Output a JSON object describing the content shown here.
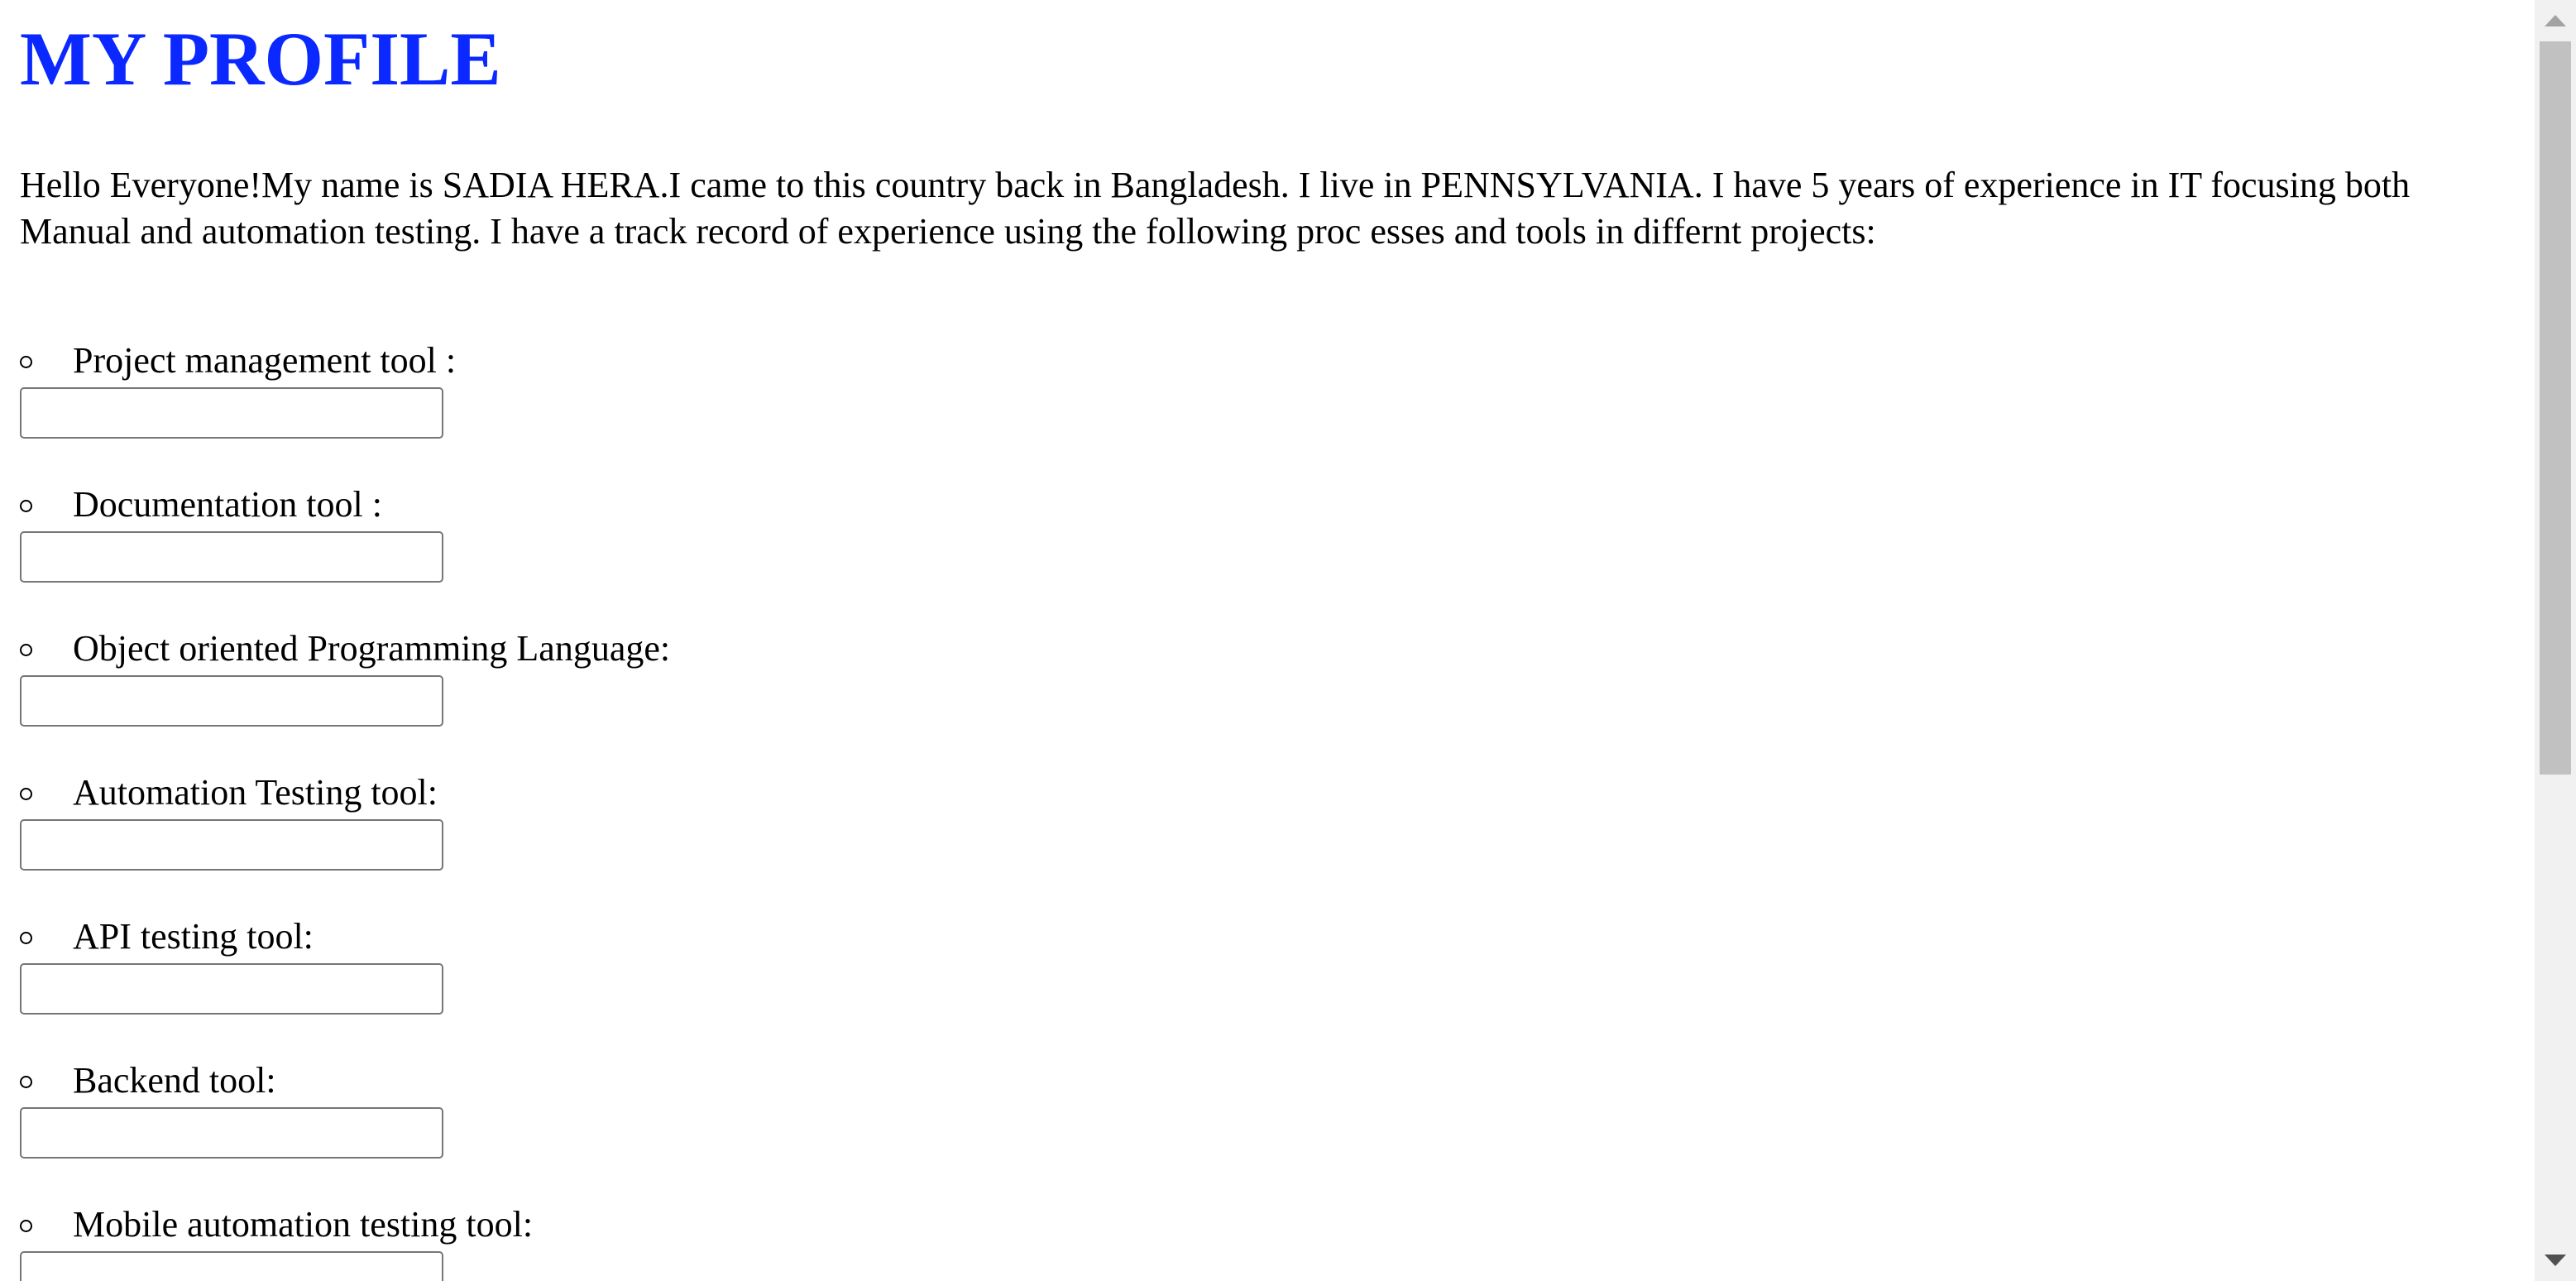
{
  "page": {
    "title": "MY PROFILE",
    "intro": "Hello Everyone!My name is SADIA HERA.I came to this country back in Bangladesh. I live in PENNSYLVANIA. I have 5 years of experience in IT focusing both Manual and automation testing. I have a track record of experience using the following proc esses and tools in differnt projects:"
  },
  "skills": [
    {
      "label": "Project management tool :",
      "value": ""
    },
    {
      "label": "Documentation tool :",
      "value": ""
    },
    {
      "label": "Object oriented Programming Language:",
      "value": ""
    },
    {
      "label": "Automation Testing tool:",
      "value": ""
    },
    {
      "label": "API testing tool:",
      "value": ""
    },
    {
      "label": "Backend tool:",
      "value": ""
    },
    {
      "label": "Mobile automation testing tool:",
      "value": ""
    }
  ],
  "colors": {
    "title": "#0a28ff",
    "text": "#000000",
    "input_border": "#767676",
    "scrollbar_track": "#f1f1f1",
    "scrollbar_thumb": "#c1c1c1"
  },
  "icons": {
    "bullet": "hollow-circle-icon",
    "scroll_up": "triangle-up-icon",
    "scroll_down": "triangle-down-icon"
  }
}
